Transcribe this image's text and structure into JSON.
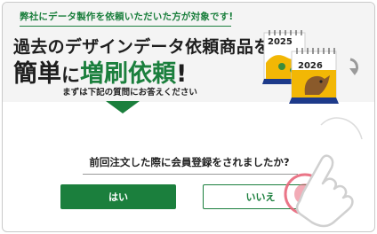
{
  "banner": {
    "sub_heading": "弊社にデータ製作を依頼いただいた方が対象です!",
    "heading_line1": "過去のデザインデータ依頼商品を",
    "heading_line2": {
      "part1": "簡単",
      "part2": "に",
      "part3": "増刷依頼",
      "part4": "!"
    },
    "caption": "まずは下記の質問にお答えください",
    "calendar_front_year": "2026",
    "calendar_back_year": "2025",
    "accent_color": "#1b7f3d"
  },
  "question": {
    "text": "前回注文した際に会員登録をされましたか?"
  },
  "buttons": {
    "yes_label": "はい",
    "no_label": "いいえ"
  },
  "icons": {
    "refresh": "refresh-arrow-icon",
    "pointer": "tap-hand-icon"
  }
}
